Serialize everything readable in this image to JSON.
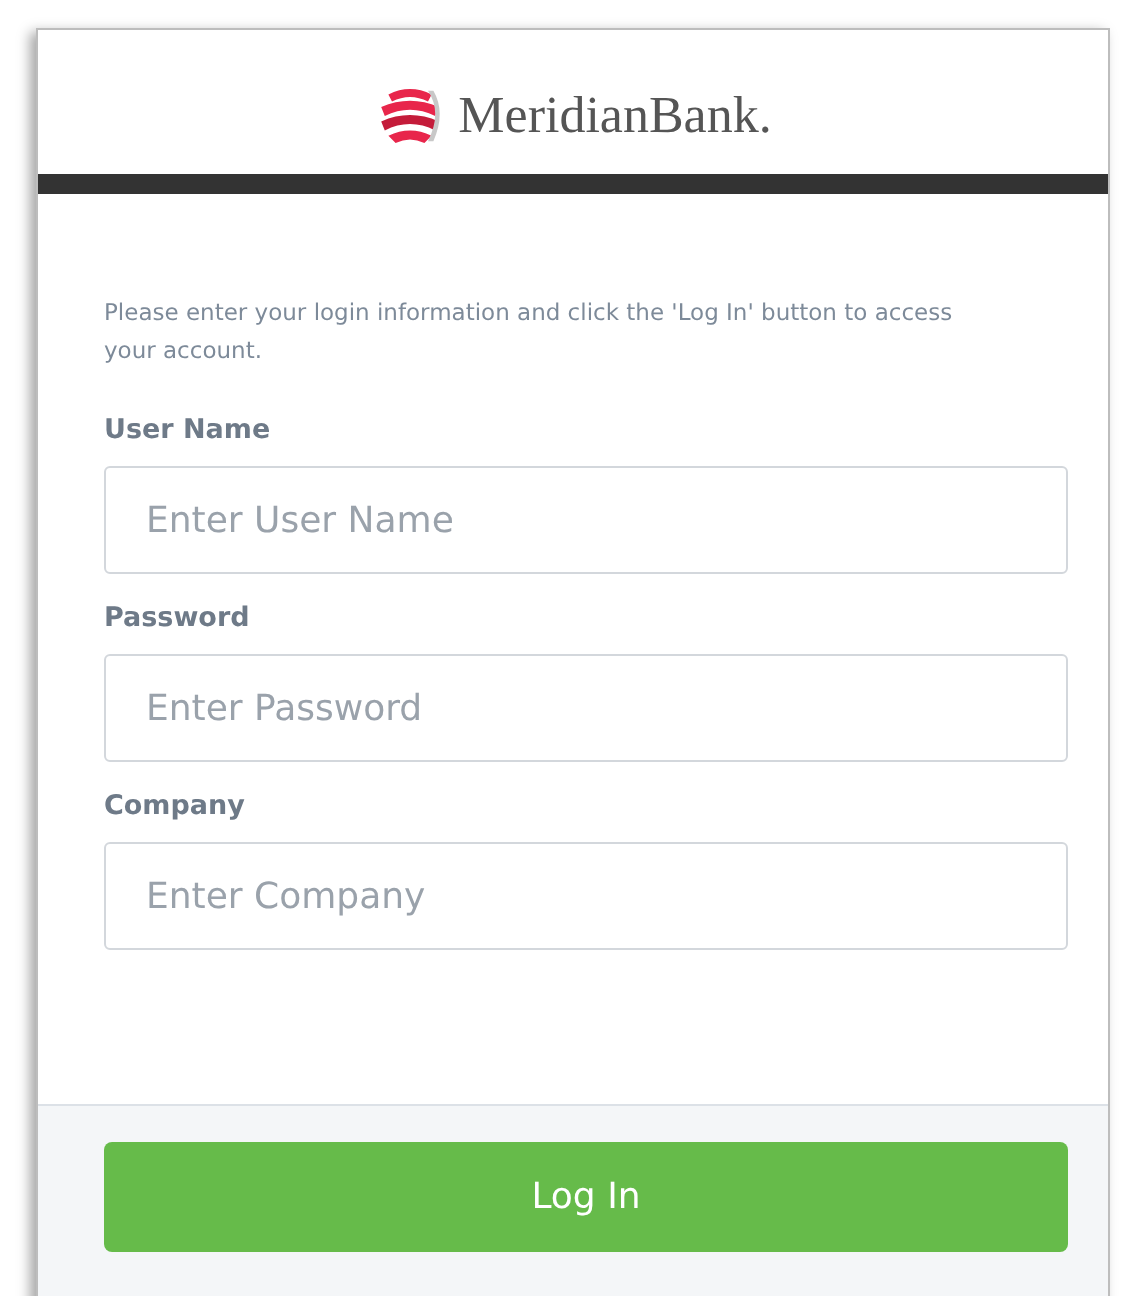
{
  "header": {
    "brand": "MeridianBank."
  },
  "intro": "Please enter your login information and click the 'Log In' button to access your account.",
  "fields": [
    {
      "label": "User Name",
      "placeholder": "Enter User Name"
    },
    {
      "label": "Password",
      "placeholder": "Enter Password"
    },
    {
      "label": "Company",
      "placeholder": "Enter Company"
    }
  ],
  "submit": "Log In"
}
